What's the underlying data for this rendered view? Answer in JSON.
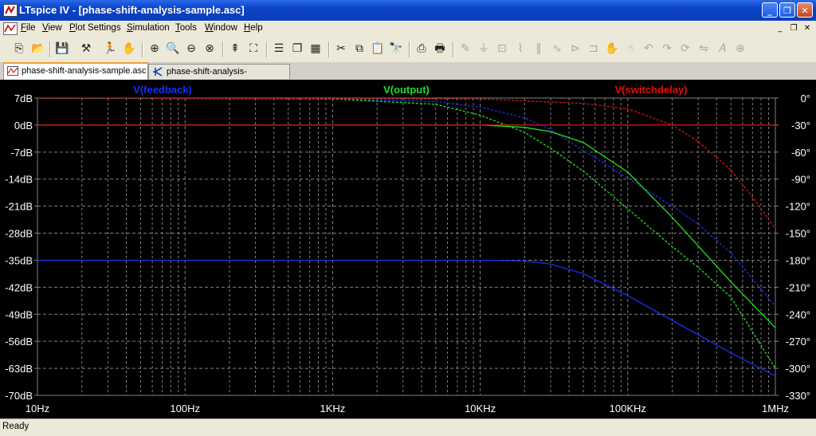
{
  "window": {
    "title": "LTspice IV - [phase-shift-analysis-sample.asc]",
    "controls": {
      "minimize": "_",
      "maximize": "❐",
      "close": "✕"
    }
  },
  "menubar": {
    "items": [
      "File",
      "View",
      "Plot Settings",
      "Simulation",
      "Tools",
      "Window",
      "Help"
    ],
    "mdi_controls": {
      "minimize": "_",
      "restore": "❐",
      "close": "✕"
    }
  },
  "toolbar": {
    "icons": [
      "new-schematic-icon",
      "open-icon",
      "save-icon",
      "control-panel-icon",
      "run-icon",
      "halt-icon",
      "zoom-in-icon",
      "zoom-full-icon",
      "zoom-out-icon",
      "zoom-cancel-icon",
      "autorange-icon",
      "zoom-to-fit-icon",
      "tile-horizontal-icon",
      "cascade-icon",
      "tile-windows-icon",
      "cut-icon",
      "copy-icon",
      "paste-icon",
      "find-icon",
      "print-preview-icon",
      "print-icon",
      "wire-icon",
      "ground-icon",
      "label-net-icon",
      "resistor-icon",
      "capacitor-icon",
      "inductor-icon",
      "diode-icon",
      "component-icon",
      "move-icon",
      "drag-icon",
      "undo-icon",
      "redo-icon",
      "rotate-icon",
      "mirror-icon",
      "text-icon",
      "spice-directive-icon"
    ]
  },
  "tabs": [
    {
      "label": "phase-shift-analysis-sample.asc",
      "icon": "waveform-icon",
      "active": true
    },
    {
      "label": "phase-shift-analysis-sample.asc",
      "icon": "schematic-icon",
      "active": false
    }
  ],
  "status": {
    "text": "Ready"
  },
  "colors": {
    "background": "#000000",
    "grid": "#808080",
    "feedback": "#1a2ef0",
    "output": "#22e022",
    "switchdelay": "#e01010",
    "axis_text": "#ffffff"
  },
  "chart_data": {
    "type": "line",
    "title": "",
    "x_scale": "log",
    "xlim": [
      10,
      1000000
    ],
    "x_ticks": [
      "10Hz",
      "100Hz",
      "1KHz",
      "10KHz",
      "100KHz",
      "1MHz"
    ],
    "x_tick_values": [
      10,
      100,
      1000,
      10000,
      100000,
      1000000
    ],
    "left_axis": {
      "unit": "dB",
      "ylim": [
        -70,
        7
      ],
      "ticks": [
        "7dB",
        "0dB",
        "-7dB",
        "-14dB",
        "-21dB",
        "-28dB",
        "-35dB",
        "-42dB",
        "-49dB",
        "-56dB",
        "-63dB",
        "-70dB"
      ],
      "tick_values": [
        7,
        0,
        -7,
        -14,
        -21,
        -28,
        -35,
        -42,
        -49,
        -56,
        -63,
        -70
      ]
    },
    "right_axis": {
      "unit": "°",
      "ylim": [
        -330,
        0
      ],
      "ticks": [
        "0°",
        "-30°",
        "-60°",
        "-90°",
        "-120°",
        "-150°",
        "-180°",
        "-210°",
        "-240°",
        "-270°",
        "-300°",
        "-330°"
      ],
      "tick_values": [
        0,
        -30,
        -60,
        -90,
        -120,
        -150,
        -180,
        -210,
        -240,
        -270,
        -300,
        -330
      ]
    },
    "grid": true,
    "legend": [
      "V(feedback)",
      "V(output)",
      "V(switchdelay)"
    ],
    "series": [
      {
        "name": "V(feedback)",
        "kind": "magnitude",
        "x": [
          10,
          1000,
          10000,
          20000,
          30000,
          50000,
          100000,
          200000,
          500000,
          1000000
        ],
        "y": [
          -35,
          -35,
          -35,
          -35.2,
          -36,
          -38.5,
          -44.2,
          -50.6,
          -59,
          -65
        ]
      },
      {
        "name": "V(feedback)",
        "kind": "phase",
        "x": [
          10,
          1000,
          5000,
          10000,
          20000,
          30000,
          50000,
          100000,
          200000,
          300000,
          500000,
          1000000
        ],
        "y": [
          -0.1,
          -1,
          -4,
          -10,
          -22,
          -35,
          -58,
          -89,
          -120,
          -140,
          -172,
          -231
        ]
      },
      {
        "name": "V(output)",
        "kind": "magnitude",
        "x": [
          10,
          1000,
          10000,
          20000,
          30000,
          50000,
          100000,
          200000,
          500000,
          1000000
        ],
        "y": [
          0,
          0,
          0,
          -0.6,
          -1.7,
          -4.5,
          -12.2,
          -23.9,
          -40.6,
          -52.5
        ]
      },
      {
        "name": "V(output)",
        "kind": "phase",
        "x": [
          10,
          1000,
          5000,
          10000,
          20000,
          30000,
          50000,
          100000,
          200000,
          300000,
          500000,
          1000000
        ],
        "y": [
          -0.1,
          -1,
          -7,
          -19,
          -38,
          -56,
          -81,
          -123,
          -165,
          -188,
          -221,
          -300
        ]
      },
      {
        "name": "V(switchdelay)",
        "kind": "magnitude",
        "x": [
          10,
          1000,
          10000,
          100000,
          1000000
        ],
        "y": [
          0,
          0,
          0,
          0,
          0
        ]
      },
      {
        "name": "V(switchdelay)",
        "kind": "phase",
        "x": [
          10,
          10000,
          50000,
          100000,
          200000,
          300000,
          500000,
          700000,
          1000000
        ],
        "y": [
          0,
          -1,
          -6,
          -12,
          -30,
          -48,
          -80,
          -110,
          -145
        ]
      }
    ]
  }
}
